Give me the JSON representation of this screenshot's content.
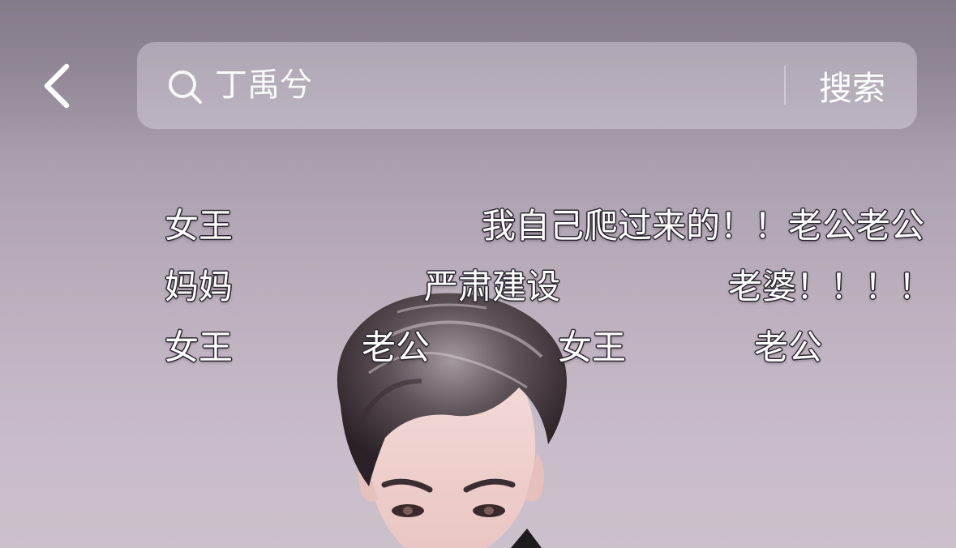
{
  "topbar": {
    "back_icon": "chevron-left-icon",
    "search": {
      "placeholder": "丁禹兮",
      "icon": "search-icon",
      "button_label": "搜索"
    }
  },
  "danmaku": {
    "row1": [
      "女王",
      "我自己爬过来的！！老公老公"
    ],
    "row2": [
      "妈妈",
      "严肃建设",
      "老婆！！！！"
    ],
    "row3": [
      "女王",
      "老公",
      "女王",
      "老公"
    ]
  },
  "colors": {
    "text": "#ffffff",
    "outline": "#2b2430",
    "search_bg": "rgba(235,230,237,0.38)"
  }
}
